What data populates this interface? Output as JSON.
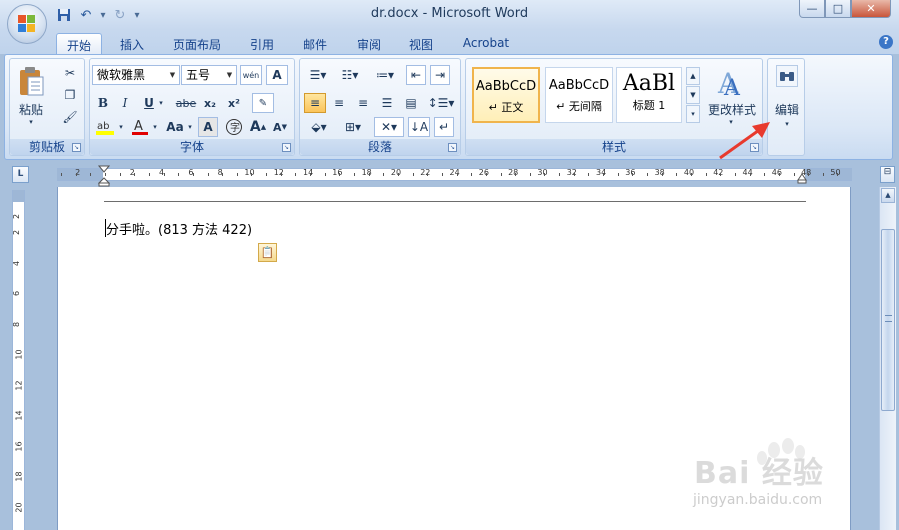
{
  "window": {
    "title": "dr.docx - Microsoft Word",
    "minimize": "—",
    "restore": "□",
    "close": "✕"
  },
  "tabs": [
    {
      "label": "开始",
      "active": true
    },
    {
      "label": "插入"
    },
    {
      "label": "页面布局"
    },
    {
      "label": "引用"
    },
    {
      "label": "邮件"
    },
    {
      "label": "审阅"
    },
    {
      "label": "视图"
    },
    {
      "label": "Acrobat"
    }
  ],
  "help_label": "?",
  "ribbon": {
    "clipboard": {
      "group_label": "剪贴板",
      "paste_label": "粘贴"
    },
    "font": {
      "group_label": "字体",
      "font_name": "微软雅黑",
      "font_size": "五号",
      "phonetic": "wén",
      "bold": "B",
      "italic": "I",
      "underline": "U",
      "strike": "abe",
      "subscript": "x₂",
      "superscript": "x²",
      "change_case": "Aa",
      "grow": "A",
      "shrink": "A"
    },
    "paragraph": {
      "group_label": "段落"
    },
    "styles": {
      "group_label": "样式",
      "items": [
        {
          "sample": "AaBbCcD",
          "name": "↵ 正文",
          "selected": true
        },
        {
          "sample": "AaBbCcD",
          "name": "↵ 无间隔"
        },
        {
          "sample": "AaBl",
          "name": "标题 1"
        }
      ],
      "change_styles_label": "更改样式"
    },
    "editing": {
      "label": "编辑"
    }
  },
  "ruler": {
    "corner": "L",
    "numbers": [
      "2",
      "2",
      "4",
      "6",
      "8",
      "10",
      "12",
      "14",
      "16",
      "18",
      "20",
      "22",
      "24",
      "26",
      "28",
      "30",
      "32",
      "34",
      "36",
      "38",
      "40",
      "42",
      "44",
      "46",
      "48",
      "50"
    ],
    "vnumbers": [
      "2",
      "2",
      "4",
      "6",
      "8",
      "10",
      "12",
      "14",
      "16",
      "18",
      "20"
    ]
  },
  "document": {
    "text": "分手啦。(813 方法 422)"
  },
  "watermark": {
    "text": "Bai 经验",
    "sub": "jingyan.baidu.com"
  },
  "colors": {
    "accent": "#15428b",
    "annotation": "#e83a2e"
  }
}
